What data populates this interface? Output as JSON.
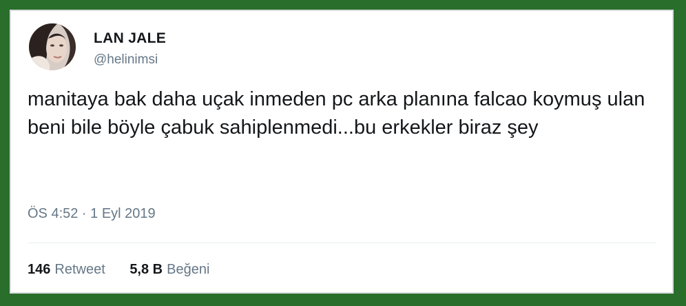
{
  "tweet": {
    "display_name": "LAN JALE",
    "handle": "@helinimsi",
    "text": "manitaya bak daha uçak inmeden pc arka planına falcao koymuş ulan beni bile böyle çabuk sahiplenmedi...bu erkekler biraz şey",
    "timestamp": "ÖS 4:52 · 1 Eyl 2019"
  },
  "stats": {
    "retweets_count": "146",
    "retweets_label": "Retweet",
    "likes_count": "5,8 B",
    "likes_label": "Beğeni"
  },
  "colors": {
    "frame": "#2a6e2c",
    "text": "#14171a",
    "secondary_text": "#657786"
  }
}
